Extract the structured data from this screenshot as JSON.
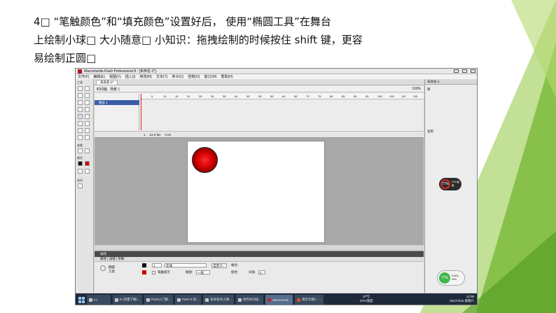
{
  "slide": {
    "line1": "4□ “笔触颜色”和“填充颜色”设置好后，  使用“椭圆工具”在舞台",
    "line2": "上绘制小球□ 大小随意□ 小知识：拖拽绘制的时候按住 shift 键，更容",
    "line3": "易绘制正圆□"
  },
  "window": {
    "title": "Macromedia Flash Professional 8 - [未命名-2*]"
  },
  "menu": [
    "文件(F)",
    "编辑(E)",
    "视图(V)",
    "插入(I)",
    "修改(M)",
    "文本(T)",
    "命令(C)",
    "控制(O)",
    "窗口(W)",
    "帮助(H)"
  ],
  "tools": {
    "tools_label": "工具",
    "view_label": "查看",
    "colors_label": "颜色",
    "options_label": "选项"
  },
  "timeline": {
    "tab": "未命名-2*",
    "timeline_btn": "时间轴",
    "scene": "场景 1",
    "layer": "图层 1",
    "zoom": "100%",
    "frame": "1",
    "fps": "12.0 fps",
    "time": "0.0s",
    "ruler": [
      "5",
      "10",
      "15",
      "20",
      "25",
      "30",
      "35",
      "40",
      "45",
      "50",
      "55",
      "60",
      "65",
      "70",
      "75",
      "80",
      "85",
      "90",
      "95",
      "100",
      "105",
      "110",
      "115"
    ]
  },
  "properties": {
    "actions": "动作",
    "tabs": "属性 | 滤镜 | 参数",
    "tool_name": "椭圆\n工具",
    "stroke_width": "1",
    "style": "实线",
    "custom": "自定义...",
    "cap": "端点:",
    "join": "接合:",
    "hint": "笔触提示",
    "scale": "缩放:",
    "scale_val": "一般",
    "corner": "尖角:",
    "corner_val": "3"
  },
  "right_panel": {
    "library_title": "未命名-2",
    "library_label": "库",
    "name_col": "名称",
    "cpu_percent": "77%",
    "cpu_label": "CPU温度"
  },
  "taskbar": {
    "items": [
      "F:\\",
      "E:\\流量下载\\...",
      "Flash入门教...",
      "Flash 8 动...",
      "未命名的小球...",
      "动作补间动...",
      "Macromedi...",
      "演示文稿1 - ..."
    ],
    "temp": "37℃\nCPU温度",
    "clock": "12:09\n2017/4/15 星期六",
    "cpu_green": "77%",
    "net_up": "5.6K/s",
    "net_down": "0K/s"
  }
}
